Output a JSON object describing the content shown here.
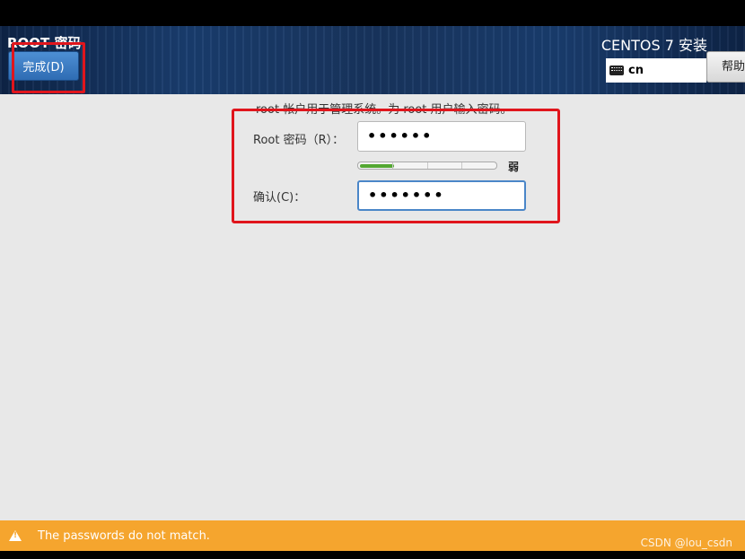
{
  "header": {
    "title": "ROOT 密码",
    "done_button": "完成(D)",
    "product": "CENTOS 7 安装",
    "keyboard_layout": "cn",
    "help_button": "帮助"
  },
  "form": {
    "intro": "root 帐户用于管理系统。为 root 用户输入密码。",
    "root_password_label": "Root 密码（R）：",
    "root_password_value": "••••••",
    "strength_label": "弱",
    "strength_fraction": 0.25,
    "confirm_label": "确认(C)：",
    "confirm_value": "•••••••"
  },
  "status_bar": {
    "message": "The passwords do not match.",
    "icon": "warning-icon",
    "color": "#f5a52e"
  },
  "watermark": "CSDN @lou_csdn",
  "colors": {
    "accent": "#4a86c8",
    "annotation": "#e0151c",
    "strength": "#54a832"
  }
}
